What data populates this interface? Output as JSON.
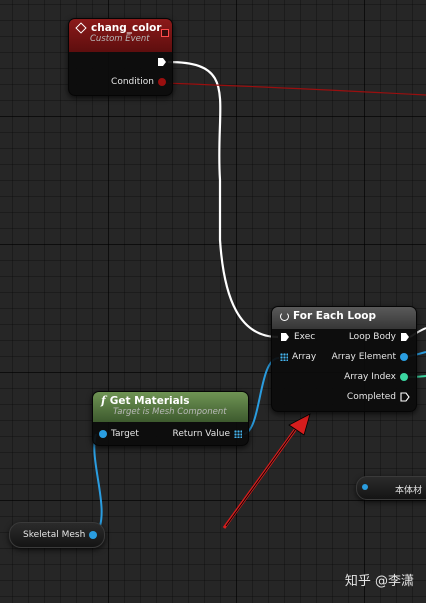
{
  "nodes": {
    "custom_event": {
      "title": "chang_color",
      "subtitle": "Custom Event",
      "condition_label": "Condition",
      "header_color": "#8b1a1a"
    },
    "for_each": {
      "title": "For Each Loop",
      "pin_exec": "Exec",
      "pin_array": "Array",
      "pin_loop_body": "Loop Body",
      "pin_array_element": "Array Element",
      "pin_array_index": "Array Index",
      "pin_completed": "Completed"
    },
    "get_materials": {
      "title": "Get Materials",
      "subtitle": "Target is Mesh Component",
      "pin_target": "Target",
      "pin_return": "Return Value",
      "header_color": "#5c7f45"
    },
    "skeletal_mesh": {
      "label": "Skeletal Mesh"
    },
    "partial_node": {
      "label": "本体材"
    }
  },
  "watermark": "知乎 @李潇",
  "colors": {
    "exec_wire": "#ffffff",
    "condition_wire": "#9a0f0f",
    "object_pin": "#2a9de0",
    "array_pin": "#45b6f1",
    "index_pin": "#3bd6a0",
    "annotation_arrow": "#d61d1d"
  }
}
